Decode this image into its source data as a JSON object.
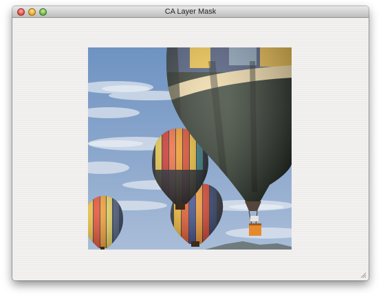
{
  "window": {
    "title": "CA Layer Mask"
  },
  "image": {
    "subject": "hot-air-balloons-photo"
  },
  "icons": [
    "close-icon",
    "minimize-icon",
    "zoom-icon",
    "resize-grip-icon"
  ]
}
